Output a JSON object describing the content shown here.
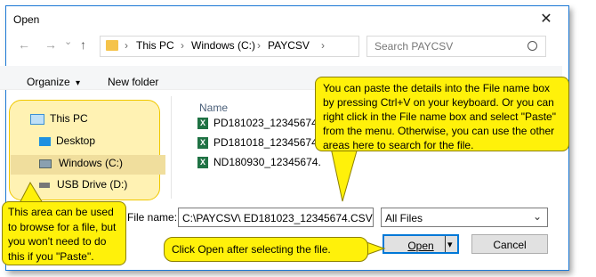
{
  "window": {
    "title": "Open",
    "close_glyph": "✕"
  },
  "nav": {
    "back": "←",
    "forward": "→",
    "dropdown": "⌄",
    "up": "↑",
    "path_sep": "›",
    "breadcrumbs": [
      "This PC",
      "Windows (C:)",
      "PAYCSV"
    ],
    "refresh": "↻"
  },
  "search": {
    "placeholder": "Search PAYCSV",
    "icon": "search-icon"
  },
  "toolbar": {
    "organize": "Organize",
    "organize_arrow": "▾",
    "new_folder": "New folder"
  },
  "sidebar": {
    "items": [
      {
        "label": "This PC",
        "icon": "computer-icon"
      },
      {
        "label": "Desktop",
        "icon": "desktop-icon"
      },
      {
        "label": "Windows (C:)",
        "icon": "drive-icon"
      },
      {
        "label": "USB Drive (D:)",
        "icon": "usb-drive-icon"
      }
    ]
  },
  "files": {
    "column_name": "Name",
    "items": [
      {
        "name": "PD181023_12345674."
      },
      {
        "name": "PD181018_12345674."
      },
      {
        "name": "ND180930_12345674."
      }
    ]
  },
  "bottom": {
    "filename_label": "File name:",
    "filename_value": "C:\\PAYCSV\\ ED181023_12345674.CSV",
    "filetype_value": "All Files",
    "open_label": "Open",
    "cancel_label": "Cancel",
    "dropdown_arrow": "⌄",
    "split_arrow": "▾"
  },
  "callouts": {
    "paste_tip": "You can paste the details into the File name box by pressing Ctrl+V on your keyboard. Or you can right click in the File name box and select \"Paste\" from the menu. Otherwise, you can use the other areas here to search for the file.",
    "browse_tip": "This area can be used to browse for a file, but you won't need to do this if you \"Paste\".",
    "open_tip": "Click Open after selecting the file."
  },
  "colors": {
    "callout_yellow": "#fff10a",
    "highlight_yellow": "#fff2b3",
    "accent_blue": "#0078d7",
    "excel_green": "#1f7244"
  }
}
